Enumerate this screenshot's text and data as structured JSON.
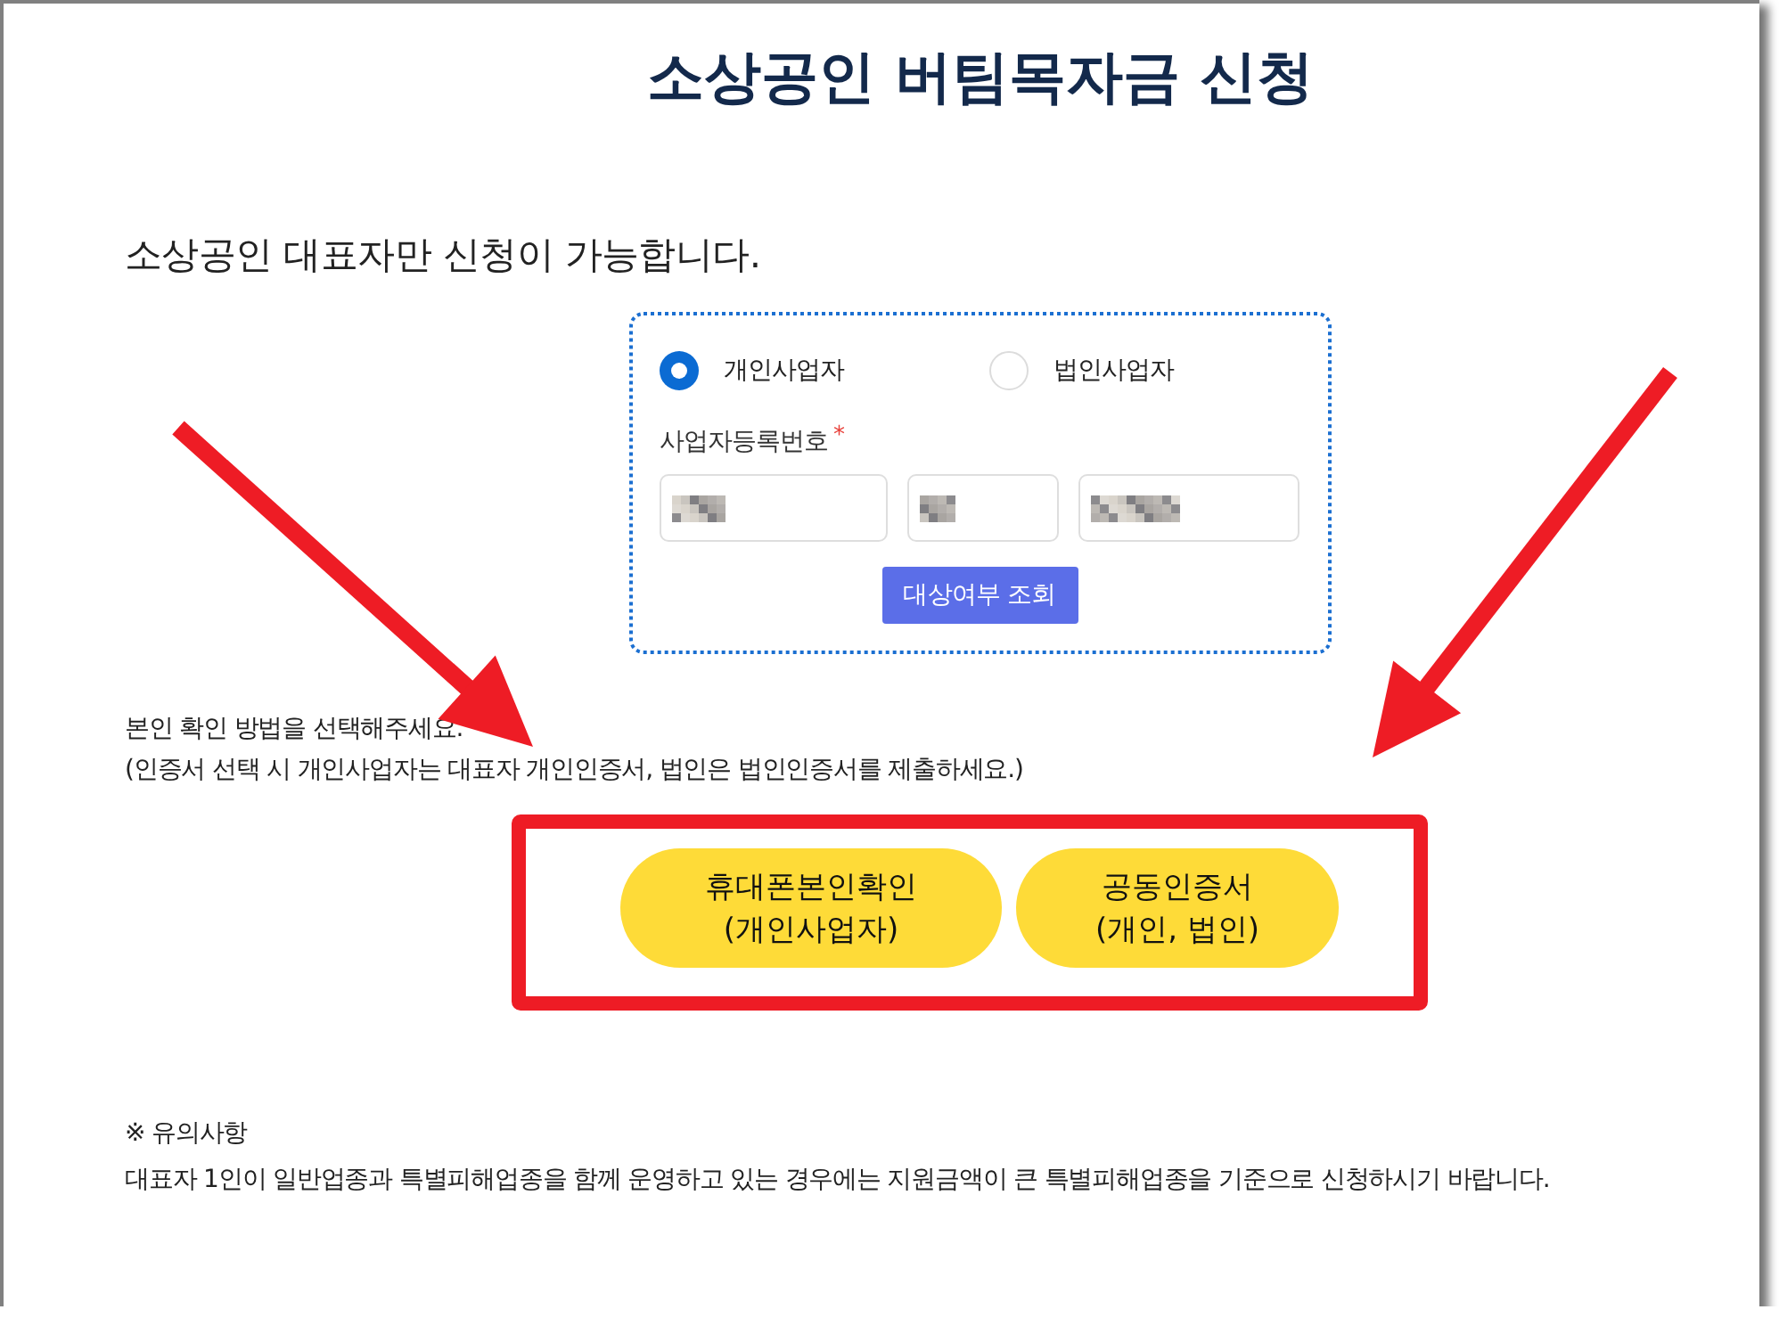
{
  "page": {
    "title": "소상공인 버팀목자금 신청",
    "notice": "소상공인 대표자만 신청이 가능합니다."
  },
  "lookup_form": {
    "business_types": [
      {
        "label": "개인사업자",
        "selected": true
      },
      {
        "label": "법인사업자",
        "selected": false
      }
    ],
    "registration_number": {
      "label": "사업자등록번호",
      "required_mark": "*",
      "fields": [
        {
          "blurred": true
        },
        {
          "blurred": true
        },
        {
          "blurred": true
        }
      ]
    },
    "button": "대상여부 조회"
  },
  "verification": {
    "instructions": [
      "본인 확인 방법을 선택해주세요.",
      "(인증서 선택 시 개인사업자는 대표자 개인인증서, 법인은 법인인증서를 제출하세요.)"
    ],
    "highlighted": true,
    "methods": [
      {
        "lines": [
          "휴대폰본인확인",
          "(개인사업자)"
        ]
      },
      {
        "lines": [
          "공동인증서",
          "(개인, 법인)"
        ]
      }
    ]
  },
  "caution": {
    "heading": "※ 유의사항",
    "text": "대표자 1인이 일반업종과 특별피해업종을 함께 운영하고 있는 경우에는 지원금액이 큰 특별피해업종을 기준으로 신청하시기 바랍니다."
  },
  "annotations": [
    {
      "kind": "arrow"
    },
    {
      "kind": "arrow"
    }
  ]
}
